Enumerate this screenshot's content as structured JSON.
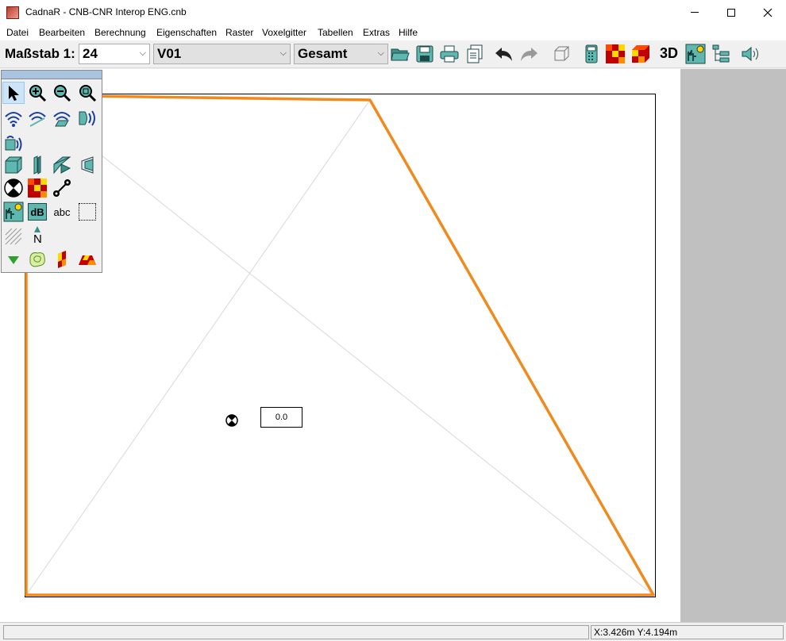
{
  "window": {
    "title": "CadnaR - CNB-CNR Interop ENG.cnb"
  },
  "menu": [
    "Datei",
    "Bearbeiten",
    "Berechnung",
    "Eigenschaften",
    "Raster",
    "Voxelgitter",
    "Tabellen",
    "Extras",
    "Hilfe"
  ],
  "toolbar": {
    "scale_label": "Maßstab 1:",
    "scale_value": "24",
    "variant_value": "V01",
    "mode_value": "Gesamt",
    "three_d_label": "3D",
    "icons": [
      "open-folder-icon",
      "save-icon",
      "print-icon",
      "copy-document-icon",
      "undo-icon",
      "redo-icon",
      "3d-box-icon",
      "calculator-icon",
      "grid-map-icon",
      "grid-3d-icon",
      "3d-label",
      "bitmap-icon",
      "tree-icon",
      "speaker-icon"
    ]
  },
  "palette": {
    "icons": [
      "pointer-icon",
      "zoom-in-icon",
      "zoom-out-icon",
      "zoom-fit-icon",
      "source-point-icon",
      "source-line-icon",
      "source-area-icon",
      "source-directional-icon",
      "source-box-icon",
      "room-block-icon",
      "wall-icon",
      "screen-icon",
      "barrier-icon",
      "receiver-icon",
      "grid-icon",
      "measure-line-icon",
      "bitmap-icon",
      "db-icon",
      "text-icon",
      "selection-rect-icon",
      "hatch-icon",
      "north-arrow-icon",
      "triangle-icon",
      "contour-icon",
      "facade-icon",
      "roof-icon"
    ],
    "db_label": "dB",
    "text_label": "abc",
    "north_label": "N"
  },
  "drawing": {
    "receiver_label": "0.0",
    "colors": {
      "room_outline": "#f08a1c",
      "guide_lines": "#d8d8d8",
      "page_border": "#000000"
    }
  },
  "status": {
    "left_text": "",
    "coords": "X:3.426m Y:4.194m"
  }
}
